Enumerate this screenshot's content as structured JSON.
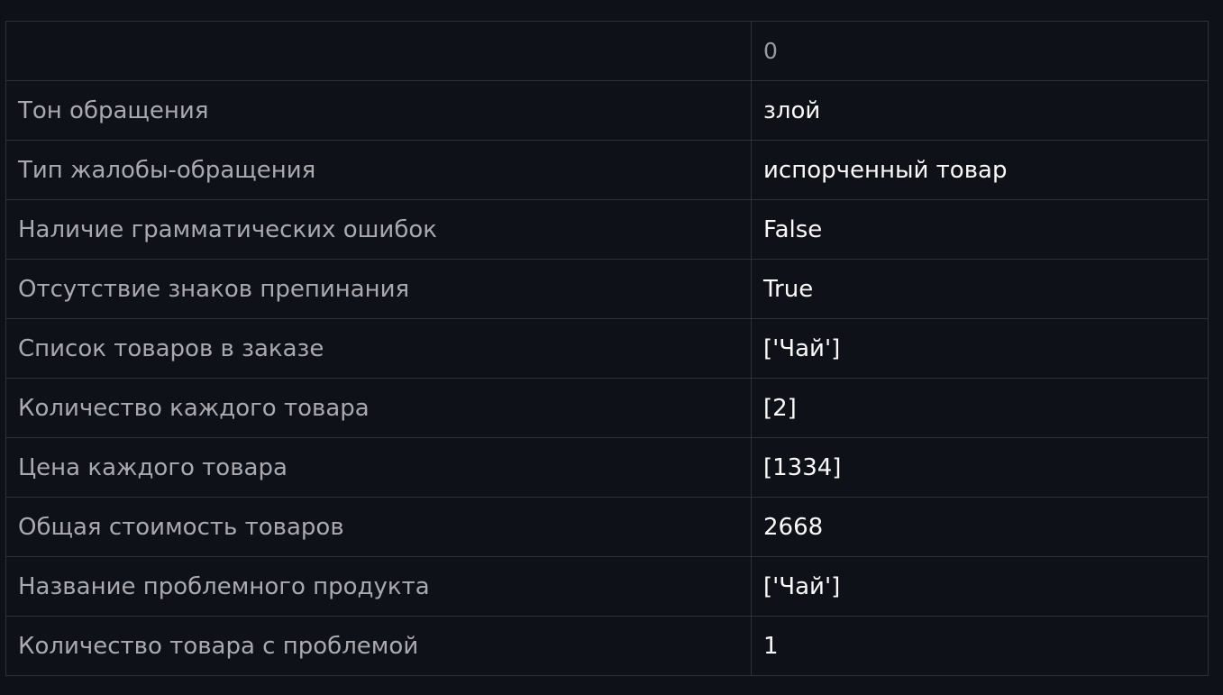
{
  "table": {
    "corner": "",
    "column_header": "0",
    "rows": [
      {
        "label": "Тон обращения",
        "value": "злой"
      },
      {
        "label": "Тип жалобы-обращения",
        "value": "испорченный товар"
      },
      {
        "label": "Наличие грамматических ошибок",
        "value": "False"
      },
      {
        "label": "Отсутствие знаков препинания",
        "value": "True"
      },
      {
        "label": "Список товаров в заказе",
        "value": "['Чай']"
      },
      {
        "label": "Количество каждого товара",
        "value": "[2]"
      },
      {
        "label": "Цена каждого товара",
        "value": "[1334]"
      },
      {
        "label": "Общая стоимость товаров",
        "value": "2668"
      },
      {
        "label": "Название проблемного продукта",
        "value": "['Чай']"
      },
      {
        "label": "Количество товара с проблемой",
        "value": "1"
      }
    ]
  },
  "colors": {
    "background": "#0e1117",
    "border": "#2f3139",
    "header_text": "#9a9ba1",
    "index_text": "#a9aab0",
    "value_text": "#fafafa"
  }
}
